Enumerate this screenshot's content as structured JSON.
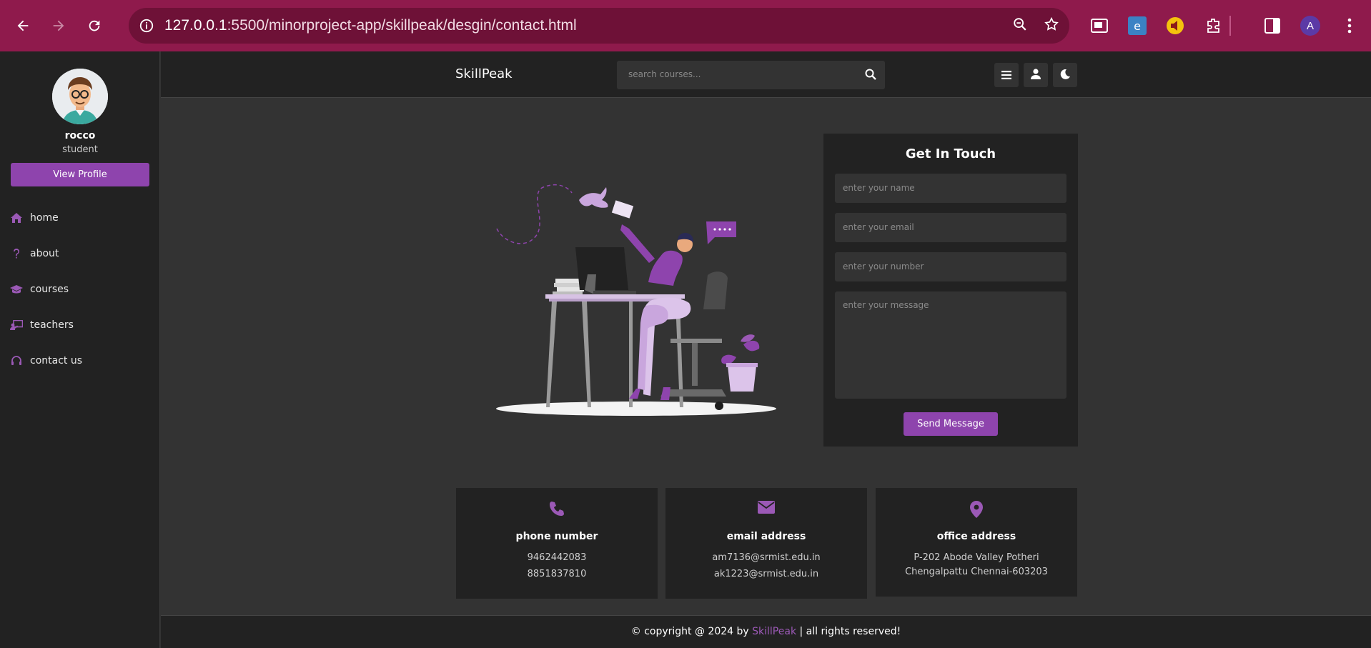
{
  "browser": {
    "url_host": "127.0.0.1",
    "url_rest": ":5500/minorproject-app/skillpeak/desgin/contact.html",
    "profile_initial": "A",
    "icons": [
      "back-icon",
      "forward-icon",
      "reload-icon",
      "info-icon",
      "zoom-out-icon",
      "star-icon",
      "picture-in-picture-icon",
      "extension-icon",
      "side-panel-icon",
      "kebab-menu-icon"
    ]
  },
  "sidebar": {
    "name": "rocco",
    "role": "student",
    "view_profile": "View Profile",
    "items": [
      {
        "label": "home",
        "icon": "home-icon"
      },
      {
        "label": "about",
        "icon": "question-icon"
      },
      {
        "label": "courses",
        "icon": "graduation-cap-icon"
      },
      {
        "label": "teachers",
        "icon": "chalkboard-teacher-icon"
      },
      {
        "label": "contact us",
        "icon": "headset-icon"
      }
    ]
  },
  "header": {
    "logo": "SkillPeak",
    "search_placeholder": "search courses..."
  },
  "contact": {
    "title": "Get In Touch",
    "name_placeholder": "enter your name",
    "email_placeholder": "enter your email",
    "number_placeholder": "enter your number",
    "message_placeholder": "enter your message",
    "send": "Send Message"
  },
  "info": [
    {
      "title": "phone number",
      "lines": [
        "9462442083",
        "8851837810"
      ],
      "icon": "phone-icon"
    },
    {
      "title": "email address",
      "lines": [
        "am7136@srmist.edu.in",
        "ak1223@srmist.edu.in"
      ],
      "icon": "envelope-icon"
    },
    {
      "title": "office address",
      "lines": [
        "P-202 Abode Valley Potheri",
        "Chengalpattu Chennai-603203"
      ],
      "icon": "map-marker-icon"
    }
  ],
  "footer": {
    "prefix": "© copyright @ 2024 by ",
    "brand": "SkillPeak",
    "suffix": " | all rights reserved!"
  },
  "colors": {
    "accent": "#8e44ad",
    "chrome": "#8f1a4c",
    "panel": "#222222",
    "background": "#333333"
  }
}
